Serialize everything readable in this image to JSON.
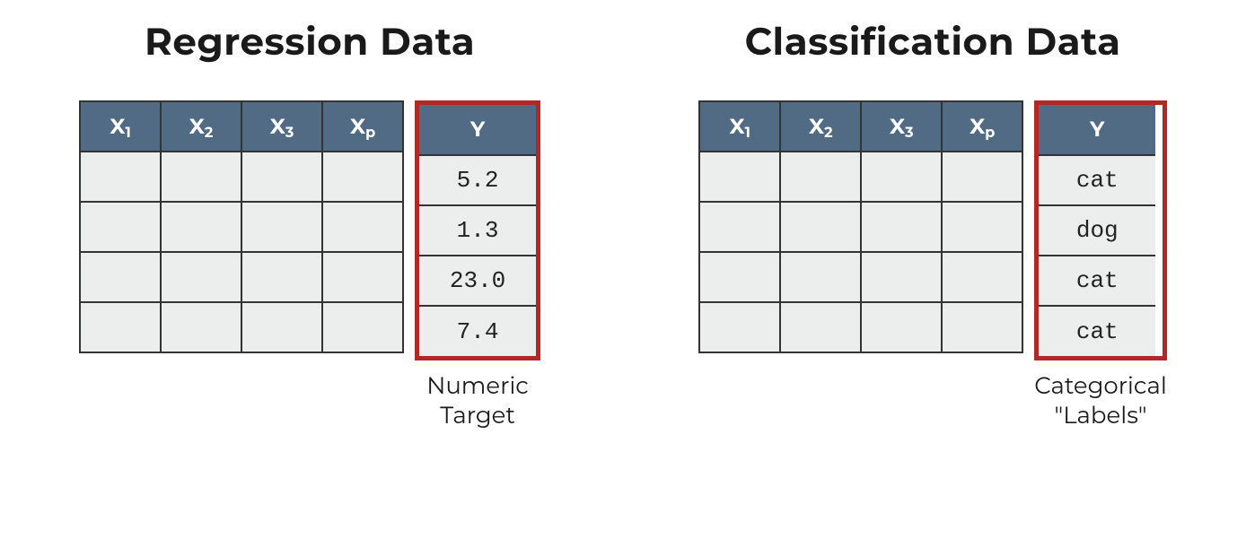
{
  "left": {
    "title": "Regression Data",
    "x_headers_base": "X",
    "x_subscripts": [
      "1",
      "2",
      "3",
      "p"
    ],
    "y_header": "Y",
    "y_values": [
      "5.2",
      "1.3",
      "23.0",
      "7.4"
    ],
    "caption_l1": "Numeric",
    "caption_l2": "Target"
  },
  "right": {
    "title": "Classification Data",
    "x_headers_base": "X",
    "x_subscripts": [
      "1",
      "2",
      "3",
      "p"
    ],
    "y_header": "Y",
    "y_values": [
      "cat",
      "dog",
      "cat",
      "cat"
    ],
    "caption_l1": "Categorical",
    "caption_l2": "\"Labels\""
  },
  "chart_data": [
    {
      "type": "table",
      "title": "Regression Data",
      "columns": [
        "X1",
        "X2",
        "X3",
        "Xp",
        "Y"
      ],
      "Y": [
        5.2,
        1.3,
        23.0,
        7.4
      ],
      "y_description": "Numeric Target"
    },
    {
      "type": "table",
      "title": "Classification Data",
      "columns": [
        "X1",
        "X2",
        "X3",
        "Xp",
        "Y"
      ],
      "Y": [
        "cat",
        "dog",
        "cat",
        "cat"
      ],
      "y_description": "Categorical \"Labels\""
    }
  ]
}
